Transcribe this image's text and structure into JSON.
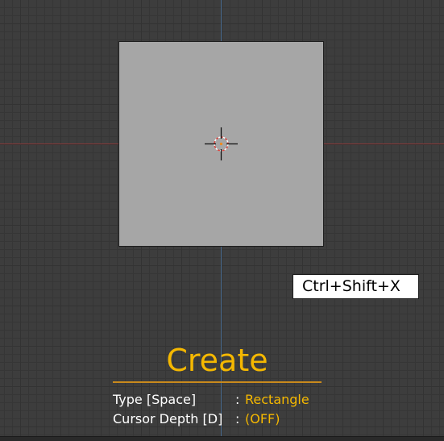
{
  "shortcut": {
    "keys": "Ctrl+Shift+X"
  },
  "operator": {
    "title": "Create",
    "hints": [
      {
        "key": "Type [Space]",
        "separator": ":",
        "value": "Rectangle"
      },
      {
        "key": "Cursor Depth [D]",
        "separator": ":",
        "value": "(OFF)"
      }
    ]
  },
  "colors": {
    "accent": "#f5b800",
    "grid_background": "#3d3d3d",
    "plane": "#a6a6a6",
    "x_axis": "#8a3a3a",
    "y_axis": "#4a6a8e"
  }
}
